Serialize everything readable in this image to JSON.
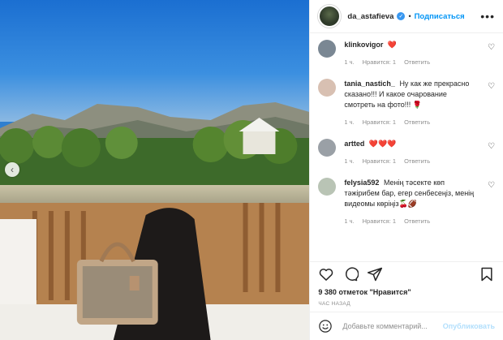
{
  "header": {
    "username": "da_astafieva",
    "follow_label": "Подписаться",
    "more_label": "•••"
  },
  "comments": [
    {
      "user": "klinkovigor",
      "text": "❤️",
      "time": "",
      "likes": "",
      "reply": ""
    },
    {
      "user": "tania_nastich_",
      "text": "Ну как же прекрасно сказано!!! И какое очарование смотреть на фото!!! 🌹",
      "time": "1 ч.",
      "likes": "Нравится: 1",
      "reply": "Ответить"
    },
    {
      "user": "artted",
      "text": "❤️❤️❤️",
      "time": "1 ч.",
      "likes": "Нравится: 1",
      "reply": "Ответить"
    },
    {
      "user": "felysia592",
      "text": "Менің тәсекте көп тәжірибем бар, егер сенбесеңіз, менің видеомы көріңіз🍒🏈",
      "time": "1 ч.",
      "likes": "Нравится: 1",
      "reply": "Ответить"
    }
  ],
  "first_comment_meta": {
    "time": "1 ч.",
    "likes": "Нравится: 1",
    "reply": "Ответить"
  },
  "likes": {
    "count": "9 380",
    "text": "отметок \"Нравится\""
  },
  "post_time": "ЧАС НАЗАД",
  "add_comment": {
    "placeholder": "Добавьте комментарий...",
    "publish_label": "Опубликовать"
  },
  "icons": {
    "like": "heart-outline-icon",
    "comment": "comment-bubble-icon",
    "share": "paper-plane-icon",
    "save": "bookmark-icon",
    "emoji": "smiley-icon",
    "verified": "verified-badge-icon",
    "carousel_prev": "chevron-left-icon"
  },
  "colors": {
    "accent": "#0095f6",
    "verified": "#3897f0",
    "heart": "#ed4956",
    "muted": "#8e8e8e"
  }
}
